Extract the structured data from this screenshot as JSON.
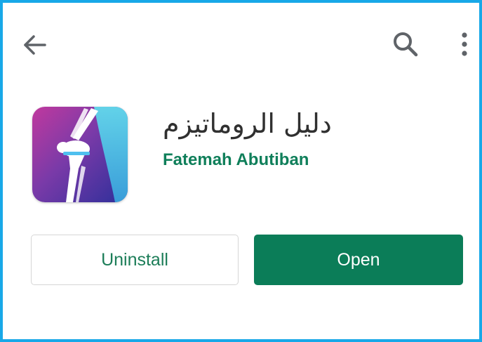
{
  "toolbar": {
    "back_icon": "arrow-left-icon",
    "search_icon": "search-icon",
    "more_icon": "more-vertical-icon",
    "icon_color": "#5f6368"
  },
  "app": {
    "title": "دليل الروماتيزم",
    "developer": "Fatemah Abutiban",
    "developer_color": "#0f7f5a",
    "icon": "knee-joint-app-icon"
  },
  "actions": {
    "uninstall_label": "Uninstall",
    "open_label": "Open",
    "accent_color": "#0b7d58"
  },
  "frame": {
    "border_color": "#18a8e8"
  }
}
